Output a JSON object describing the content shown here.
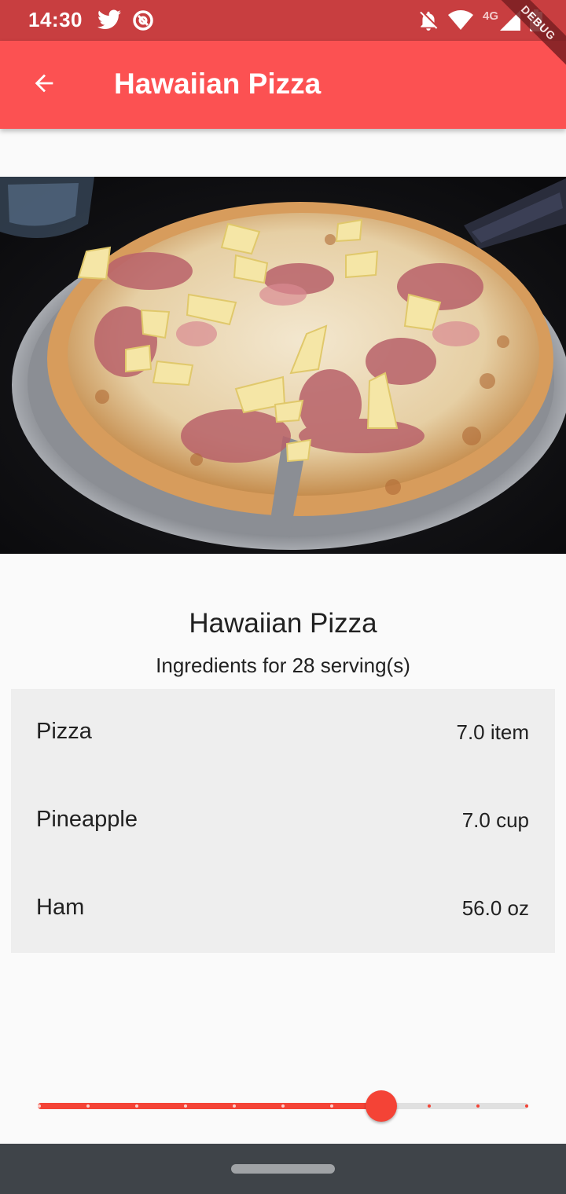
{
  "status_bar": {
    "time": "14:30",
    "network_label": "4G",
    "left_icons": [
      "twitter-icon",
      "at-sign-icon"
    ],
    "right_icons": [
      "notifications-off-icon",
      "wifi-icon",
      "signal-icon",
      "battery-charging-icon"
    ]
  },
  "debug_banner": "DEBUG",
  "app_bar": {
    "title": "Hawaiian Pizza",
    "back_icon": "arrow-back-icon"
  },
  "recipe": {
    "title": "Hawaiian Pizza",
    "servings_label": "Ingredients for 28 serving(s)",
    "ingredients": [
      {
        "name": "Pizza",
        "amount": "7.0 item"
      },
      {
        "name": "Pineapple",
        "amount": "7.0 cup"
      },
      {
        "name": "Ham",
        "amount": "56.0 oz"
      }
    ]
  },
  "servings_slider": {
    "divisions": 10,
    "value_fraction": 0.7
  },
  "colors": {
    "status_bar": "#c83e40",
    "app_bar": "#fc5152",
    "accent": "#f44336",
    "background": "#fafafa",
    "ingredient_card": "#eeeeee",
    "nav_bar": "#3f4449"
  }
}
